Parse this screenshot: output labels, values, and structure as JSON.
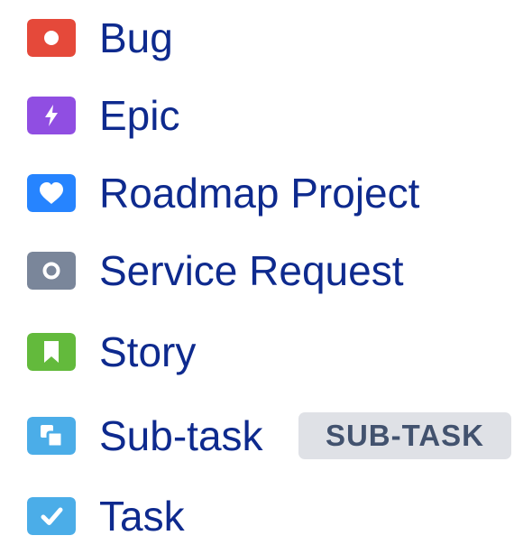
{
  "issue_types": [
    {
      "label": "Bug",
      "icon": "bug-icon",
      "color": "#e5493a"
    },
    {
      "label": "Epic",
      "icon": "epic-icon",
      "color": "#904ee2"
    },
    {
      "label": "Roadmap Project",
      "icon": "roadmap-heart-icon",
      "color": "#2684ff"
    },
    {
      "label": "Service Request",
      "icon": "service-request-icon",
      "color": "#7a869a"
    },
    {
      "label": "Story",
      "icon": "story-icon",
      "color": "#63ba3c"
    },
    {
      "label": "Sub-task",
      "icon": "subtask-icon",
      "color": "#4bade8",
      "badge": "SUB-TASK"
    },
    {
      "label": "Task",
      "icon": "task-icon",
      "color": "#4bade8"
    }
  ],
  "colors": {
    "label_text": "#0e2a8e",
    "badge_background": "#dfe1e6",
    "badge_text": "#42526e"
  }
}
